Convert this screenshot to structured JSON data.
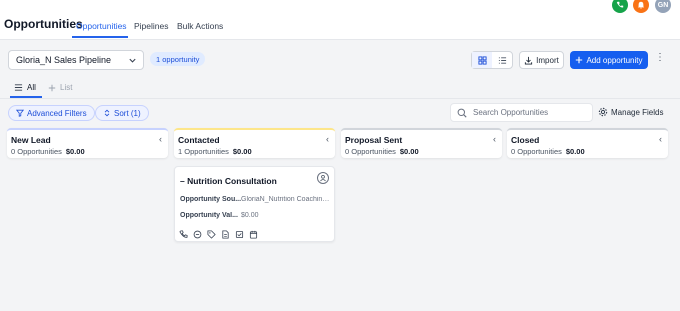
{
  "header": {
    "title": "Opportunities",
    "tabs": [
      {
        "label": "Opportunities",
        "active": true
      },
      {
        "label": "Pipelines",
        "active": false
      },
      {
        "label": "Bulk Actions",
        "active": false
      }
    ],
    "avatar_initials": "GN"
  },
  "toolbar": {
    "pipeline_value": "Gloria_N Sales Pipeline",
    "count_badge": "1 opportunity",
    "import_label": "Import",
    "add_label": "Add opportunity"
  },
  "view_tabs": {
    "all_label": "All",
    "list_label": "List"
  },
  "filters": {
    "advanced_label": "Advanced Filters",
    "sort_label": "Sort (1)",
    "search_placeholder": "Search Opportunities",
    "manage_fields_label": "Manage Fields"
  },
  "columns": [
    {
      "name": "New Lead",
      "count": "0 Opportunities",
      "value": "$0.00"
    },
    {
      "name": "Contacted",
      "count": "1 Opportunities",
      "value": "$0.00"
    },
    {
      "name": "Proposal Sent",
      "count": "0 Opportunities",
      "value": "$0.00"
    },
    {
      "name": "Closed",
      "count": "0 Opportunities",
      "value": "$0.00"
    }
  ],
  "card": {
    "title": "– Nutrition Consultation",
    "source_label": "Opportunity Sou...",
    "source_value": "GloriaN_Nutrition Coaching_...",
    "value_label": "Opportunity Val...",
    "value_value": "$0.00",
    "actions": [
      "phone-icon",
      "chat-icon",
      "tag-icon",
      "document-icon",
      "task-icon",
      "calendar-icon"
    ]
  },
  "colors": {
    "accent": "#155eef",
    "phone_button": "#16a34a",
    "bell_button": "#f97316",
    "avatar": "#94a3b8"
  }
}
